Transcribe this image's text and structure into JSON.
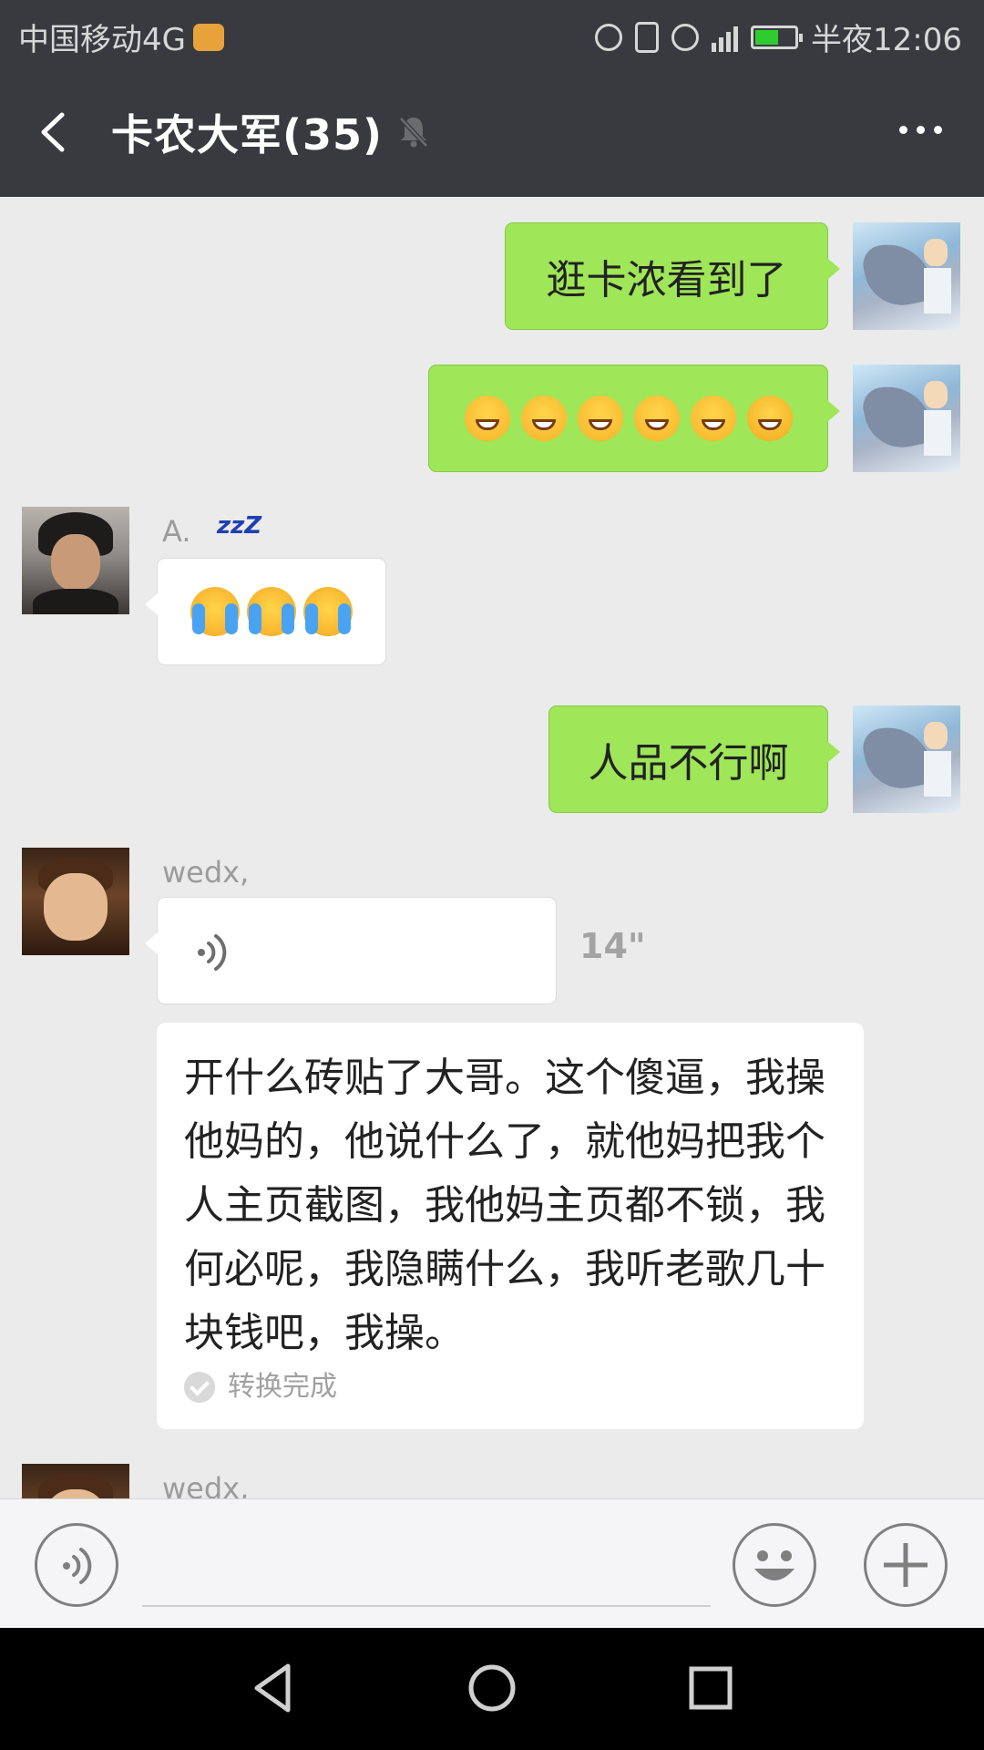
{
  "status_bar": {
    "carrier": "中国移动4G",
    "time": "半夜12:06",
    "battery_level": 0.6
  },
  "header": {
    "title": "卡农大军(35)",
    "back_icon": "back-chevron-icon",
    "mute_icon": "bell-muted-icon",
    "more_icon": "more-dots-icon"
  },
  "messages": [
    {
      "from": "me",
      "type": "text",
      "text": "逛卡浓看到了"
    },
    {
      "from": "me",
      "type": "emoji",
      "emojis": [
        "grin",
        "grin",
        "grin",
        "grin",
        "grin",
        "sweat-smirk"
      ]
    },
    {
      "from": "A.",
      "name": "A.",
      "name_suffix": "zzZ",
      "type": "emoji",
      "emojis": [
        "cry-laugh",
        "cry-laugh",
        "cry-laugh"
      ]
    },
    {
      "from": "me",
      "type": "text",
      "text": "人品不行啊"
    },
    {
      "from": "wedx",
      "name": "wedx,",
      "type": "voice",
      "duration": "14\"",
      "transcript": "开什么砖贴了大哥。这个傻逼，我操他妈的，他说什么了，就他妈把我个人主页截图，我他妈主页都不锁，我何必呢，我隐瞒什么，我听老歌几十块钱吧，我操。",
      "transcript_status": "转换完成"
    },
    {
      "from": "wedx",
      "name": "wedx,",
      "type": "partial"
    }
  ],
  "input_bar": {
    "voice_icon": "voice-input-icon",
    "emoji_icon": "emoji-face-icon",
    "plus_icon": "plus-icon"
  },
  "colors": {
    "header_bg": "#393a3f",
    "chat_bg": "#ebebeb",
    "my_bubble": "#9fe658",
    "other_bubble": "#ffffff"
  }
}
